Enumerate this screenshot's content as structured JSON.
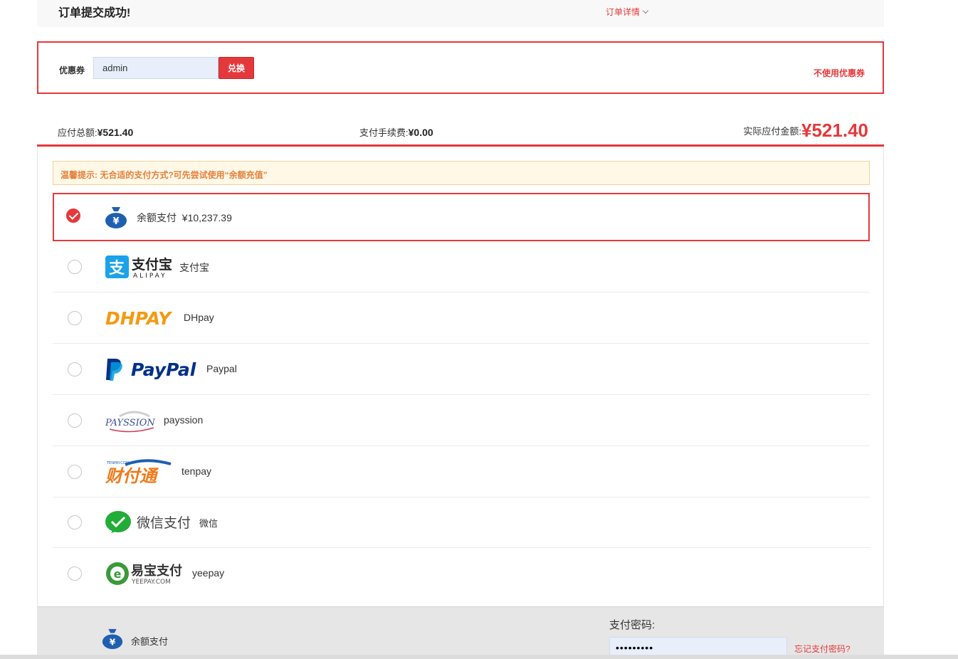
{
  "header": {
    "title": "订单提交成功!",
    "order_detail_label": "订单详情"
  },
  "coupon": {
    "label": "优惠券",
    "input_value": "admin",
    "redeem_button": "兑换",
    "no_coupon_link": "不使用优惠券"
  },
  "totals": {
    "total_label": "应付总额:",
    "total_value": "¥521.40",
    "fee_label": "支付手续费:",
    "fee_value": "¥0.00",
    "actual_label": "实际应付金额:",
    "actual_value": "¥521.40"
  },
  "tip": "温馨提示: 无合适的支付方式?可先尝试使用“余额充值”",
  "payment_methods": [
    {
      "name": "余额支付",
      "extra": "¥10,237.39",
      "icon": "money-bag-icon",
      "selected": true
    },
    {
      "name": "支付宝",
      "logo_main": "支付宝",
      "logo_sub": "ALIPAY",
      "icon": "alipay-logo",
      "selected": false
    },
    {
      "name": "DHpay",
      "logo_main": "DHPAY",
      "icon": "dhpay-logo",
      "selected": false
    },
    {
      "name": "Paypal",
      "logo_main": "PayPal",
      "icon": "paypal-logo",
      "selected": false
    },
    {
      "name": "payssion",
      "logo_main": "PAYSSION",
      "icon": "payssion-logo",
      "selected": false
    },
    {
      "name": "tenpay",
      "logo_main": "财付通",
      "logo_sub": "TENPAY.COM",
      "icon": "tenpay-logo",
      "selected": false
    },
    {
      "name": "微信",
      "logo_main": "微信支付",
      "icon": "wechat-pay-logo",
      "selected": false
    },
    {
      "name": "yeepay",
      "logo_main": "易宝支付",
      "logo_sub": "YEEPAY.COM",
      "icon": "yeepay-logo",
      "selected": false
    }
  ],
  "footer": {
    "method_name": "余额支付",
    "password_label": "支付密码:",
    "password_value": "•••••••••",
    "forgot_link": "忘记支付密码?"
  },
  "colors": {
    "accent": "#e4393c",
    "tip_bg": "#fff8e7",
    "tip_text": "#e4813c"
  }
}
